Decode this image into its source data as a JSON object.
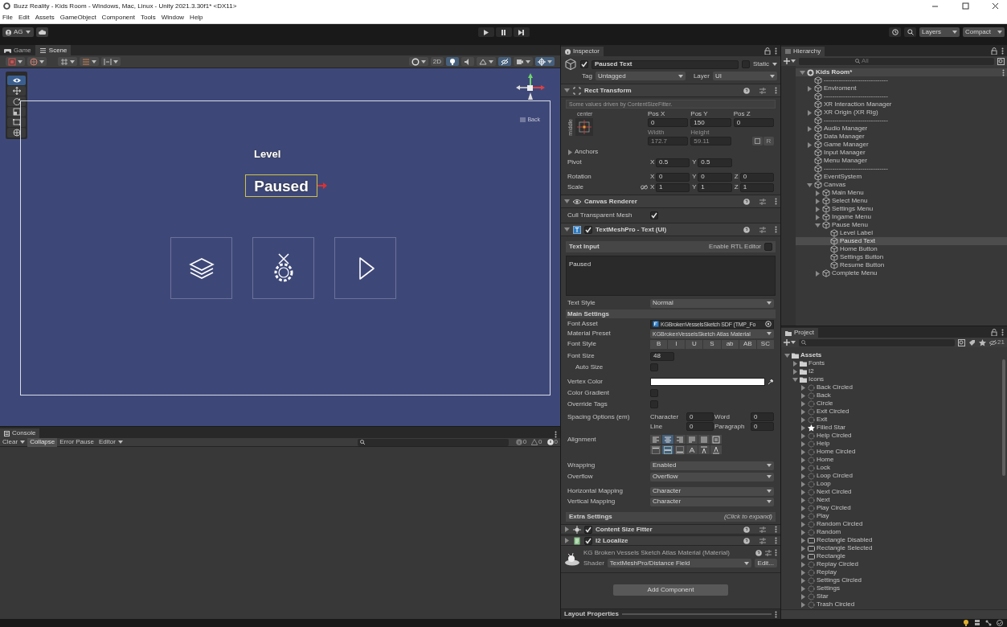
{
  "window": {
    "title": "Buzz Reality - Kids Room - Windows, Mac, Linux - Unity 2021.3.30f1* <DX11>"
  },
  "menu": [
    "File",
    "Edit",
    "Assets",
    "GameObject",
    "Component",
    "Tools",
    "Window",
    "Help"
  ],
  "toolbar": {
    "account": "AG",
    "layers": "Layers",
    "layout": "Compact"
  },
  "scene_panel": {
    "tabs": [
      {
        "label": "Game",
        "kind": "game",
        "selected": false
      },
      {
        "label": "Scene",
        "kind": "scene",
        "selected": true
      }
    ],
    "toolbar_left": [
      {
        "kind": "shading",
        "on": false,
        "dropdown": true
      },
      {
        "kind": "globe",
        "on": false,
        "dropdown": true
      },
      {
        "kind": "grid",
        "on": false,
        "dropdown": true
      },
      {
        "kind": "snap",
        "on": false,
        "dropdown": true
      },
      {
        "kind": "increment",
        "on": false,
        "dropdown": true
      }
    ],
    "toolbar_right": [
      {
        "kind": "orientation",
        "on": false,
        "dropdown": true
      },
      {
        "kind": "mode",
        "label": "2D",
        "on": false,
        "dropdown": false
      },
      {
        "kind": "lighting",
        "on": true,
        "dropdown": false
      },
      {
        "kind": "audio",
        "on": false,
        "dropdown": false
      },
      {
        "kind": "effects",
        "on": false,
        "dropdown": true
      },
      {
        "kind": "visibility",
        "on": true,
        "dropdown": false
      },
      {
        "kind": "camera",
        "on": false,
        "dropdown": true
      },
      {
        "kind": "gizmos",
        "on": true,
        "dropdown": true
      }
    ],
    "tools": [
      {
        "kind": "view",
        "selected": true
      },
      {
        "kind": "move",
        "selected": false
      },
      {
        "kind": "rotate",
        "selected": false
      },
      {
        "kind": "scale",
        "selected": false
      },
      {
        "kind": "rect",
        "selected": false
      },
      {
        "kind": "transform",
        "selected": false
      }
    ],
    "gizmo_label": "Back",
    "canvas": {
      "level_text": "Level",
      "paused_text": "Paused",
      "buttons": [
        {
          "kind": "layers"
        },
        {
          "kind": "settings"
        },
        {
          "kind": "play"
        }
      ]
    }
  },
  "console": {
    "title": "Console",
    "buttons": [
      {
        "label": "Clear",
        "selected": false,
        "dropdown": true
      },
      {
        "label": "Collapse",
        "selected": true,
        "dropdown": false
      },
      {
        "label": "Error Pause",
        "selected": false,
        "dropdown": false
      },
      {
        "label": "Editor",
        "selected": false,
        "dropdown": true
      }
    ],
    "counts": [
      {
        "kind": "info",
        "value": "0"
      },
      {
        "kind": "warning",
        "value": "0"
      },
      {
        "kind": "error",
        "value": "0"
      }
    ]
  },
  "inspector": {
    "title": "Inspector",
    "object": {
      "active": true,
      "name": "Paused Text",
      "static": false,
      "static_label": "Static",
      "tag_label": "Tag",
      "tag": "Untagged",
      "layer_label": "Layer",
      "layer": "UI"
    },
    "rect_transform": {
      "title": "Rect Transform",
      "expanded": true,
      "note": "Some values driven by ContentSizeFitter.",
      "anchor_h": "center",
      "anchor_v": "middle",
      "fields": [
        {
          "label": "Pos X",
          "value": "0",
          "disabled": false
        },
        {
          "label": "Pos Y",
          "value": "150",
          "disabled": false
        },
        {
          "label": "Pos Z",
          "value": "0",
          "disabled": false
        },
        {
          "label": "Width",
          "value": "172.7",
          "disabled": true
        },
        {
          "label": "Height",
          "value": "59.11",
          "disabled": true
        }
      ],
      "raw_button": "R",
      "anchors": {
        "label": "Anchors",
        "expanded": false
      },
      "rows": [
        {
          "label": "Pivot",
          "linked": false,
          "axes": [
            {
              "axis": "X",
              "value": "0.5"
            },
            {
              "axis": "Y",
              "value": "0.5"
            }
          ]
        },
        {
          "label": "Rotation",
          "linked": false,
          "axes": [
            {
              "axis": "X",
              "value": "0"
            },
            {
              "axis": "Y",
              "value": "0"
            },
            {
              "axis": "Z",
              "value": "0"
            }
          ]
        },
        {
          "label": "Scale",
          "linked": true,
          "axes": [
            {
              "axis": "X",
              "value": "1"
            },
            {
              "axis": "Y",
              "value": "1"
            },
            {
              "axis": "Z",
              "value": "1"
            }
          ]
        }
      ]
    },
    "canvas_renderer": {
      "title": "Canvas Renderer",
      "expanded": true,
      "cull_label": "Cull Transparent Mesh",
      "cull": true
    },
    "text_mesh_pro": {
      "title": "TextMeshPro - Text (UI)",
      "expanded": true,
      "enabled": true,
      "text_input_label": "Text Input",
      "rtl_label": "Enable RTL Editor",
      "rtl": false,
      "text": "Paused",
      "text_style_label": "Text Style",
      "text_style": "Normal",
      "main_settings": "Main Settings",
      "font_asset_label": "Font Asset",
      "font_asset": "KGBrokenVesselsSketch SDF (TMP_Fo",
      "material_preset_label": "Material Preset",
      "material_preset": "KGBrokenVesselsSketch Atlas Material",
      "font_style_label": "Font Style",
      "font_styles": [
        {
          "label": "B",
          "selected": false
        },
        {
          "label": "I",
          "selected": false
        },
        {
          "label": "U",
          "selected": false
        },
        {
          "label": "S",
          "selected": false
        },
        {
          "label": "ab",
          "selected": false
        },
        {
          "label": "AB",
          "selected": false
        },
        {
          "label": "SC",
          "selected": false
        }
      ],
      "font_size_label": "Font Size",
      "font_size": "48",
      "auto_size_label": "Auto Size",
      "auto_size": false,
      "vertex_color_label": "Vertex Color",
      "toggles": [
        {
          "label": "Color Gradient",
          "checked": false
        },
        {
          "label": "Override Tags",
          "checked": false
        }
      ],
      "spacing_label": "Spacing Options (em)",
      "spacing": [
        {
          "label": "Character",
          "value": "0"
        },
        {
          "label": "Word",
          "value": "0"
        },
        {
          "label": "Line",
          "value": "0"
        },
        {
          "label": "Paragraph",
          "value": "0"
        }
      ],
      "alignment_label": "Alignment",
      "alignment_rows": [
        [
          {
            "selected": false
          },
          {
            "selected": true
          },
          {
            "selected": false
          },
          {
            "selected": false
          },
          {
            "selected": false
          },
          {
            "selected": false
          }
        ],
        [
          {
            "selected": false
          },
          {
            "selected": true
          },
          {
            "selected": false
          },
          {
            "selected": false
          },
          {
            "selected": false
          },
          {
            "selected": false
          }
        ]
      ],
      "wrap_settings": [
        {
          "label": "Wrapping",
          "value": "Enabled"
        },
        {
          "label": "Overflow",
          "value": "Overflow"
        }
      ],
      "mapping_settings": [
        {
          "label": "Horizontal Mapping",
          "value": "Character"
        },
        {
          "label": "Vertical Mapping",
          "value": "Character"
        }
      ],
      "extra_settings": "Extra Settings",
      "extra_hint": "(Click to expand)"
    },
    "components": [
      {
        "title": "Content Size Fitter",
        "kind": "fitter",
        "enabled": true,
        "expanded": false
      },
      {
        "title": "I2 Localize",
        "kind": "localize",
        "enabled": true,
        "expanded": false
      }
    ],
    "material": {
      "title": "KG Broken Vessels Sketch Atlas Material (Material)",
      "shader_label": "Shader",
      "shader": "TextMeshPro/Distance Field",
      "edit": "Edit..."
    },
    "add_component": "Add Component",
    "layout_properties": "Layout Properties"
  },
  "hierarchy": {
    "title": "Hierarchy",
    "search_placeholder": "All",
    "scene": {
      "label": "Kids Room*",
      "expanded": true
    },
    "items": [
      {
        "label": "------------------------------",
        "selected": false
      },
      {
        "label": "Enviroment",
        "selected": false,
        "expanded": false
      },
      {
        "label": "------------------------------",
        "selected": false
      },
      {
        "label": "XR Interaction Manager",
        "selected": false
      },
      {
        "label": "XR Origin (XR Rig)",
        "selected": false,
        "expanded": false
      },
      {
        "label": "------------------------------",
        "selected": false
      },
      {
        "label": "Audio Manager",
        "selected": false,
        "expanded": false
      },
      {
        "label": "Data Manager",
        "selected": false
      },
      {
        "label": "Game Manager",
        "selected": false,
        "expanded": false
      },
      {
        "label": "Input Manager",
        "selected": false
      },
      {
        "label": "Menu Manager",
        "selected": false
      },
      {
        "label": "------------------------------",
        "selected": false
      },
      {
        "label": "EventSystem",
        "selected": false
      },
      {
        "label": "Canvas",
        "selected": false,
        "expanded": true,
        "children": [
          {
            "label": "Main Menu",
            "selected": false,
            "expanded": false
          },
          {
            "label": "Select Menu",
            "selected": false,
            "expanded": false
          },
          {
            "label": "Settings Menu",
            "selected": false,
            "expanded": false
          },
          {
            "label": "Ingame Menu",
            "selected": false,
            "expanded": false
          },
          {
            "label": "Pause Menu",
            "selected": false,
            "expanded": true,
            "children": [
              {
                "label": "Level Label",
                "selected": false
              },
              {
                "label": "Paused Text",
                "selected": true
              },
              {
                "label": "Home Button",
                "selected": false
              },
              {
                "label": "Settings Button",
                "selected": false
              },
              {
                "label": "Resume Button",
                "selected": false
              }
            ]
          },
          {
            "label": "Complete Menu",
            "selected": false,
            "expanded": false
          }
        ]
      }
    ]
  },
  "project": {
    "title": "Project",
    "hidden_count": "21",
    "tree": [
      {
        "label": "Assets",
        "kind": "folder",
        "expanded": true,
        "children": [
          {
            "label": "Fonts",
            "kind": "folder",
            "expanded": false
          },
          {
            "label": "I2",
            "kind": "folder",
            "expanded": false
          },
          {
            "label": "Icons",
            "kind": "folder",
            "expanded": true,
            "children": [
              {
                "label": "Back Circled",
                "kind": "sprite",
                "expanded": false
              },
              {
                "label": "Back",
                "kind": "sprite",
                "expanded": false
              },
              {
                "label": "Circle",
                "kind": "sprite",
                "expanded": false
              },
              {
                "label": "Exit Circled",
                "kind": "sprite",
                "expanded": false
              },
              {
                "label": "Exit",
                "kind": "sprite",
                "expanded": false
              },
              {
                "label": "Filled Star",
                "kind": "star",
                "expanded": false
              },
              {
                "label": "Help Circled",
                "kind": "sprite",
                "expanded": false
              },
              {
                "label": "Help",
                "kind": "sprite",
                "expanded": false
              },
              {
                "label": "Home Circled",
                "kind": "sprite",
                "expanded": false
              },
              {
                "label": "Home",
                "kind": "sprite",
                "expanded": false
              },
              {
                "label": "Lock",
                "kind": "sprite",
                "expanded": false
              },
              {
                "label": "Loop Circled",
                "kind": "sprite",
                "expanded": false
              },
              {
                "label": "Loop",
                "kind": "sprite",
                "expanded": false
              },
              {
                "label": "Next Circled",
                "kind": "sprite",
                "expanded": false
              },
              {
                "label": "Next",
                "kind": "sprite",
                "expanded": false
              },
              {
                "label": "Play Circled",
                "kind": "sprite",
                "expanded": false
              },
              {
                "label": "Play",
                "kind": "sprite",
                "expanded": false
              },
              {
                "label": "Random Circled",
                "kind": "sprite",
                "expanded": false
              },
              {
                "label": "Random",
                "kind": "sprite",
                "expanded": false
              },
              {
                "label": "Rectangle Disabled",
                "kind": "rect",
                "expanded": false
              },
              {
                "label": "Rectangle Selected",
                "kind": "rect",
                "expanded": false
              },
              {
                "label": "Rectangle",
                "kind": "rect",
                "expanded": false
              },
              {
                "label": "Replay Circled",
                "kind": "sprite",
                "expanded": false
              },
              {
                "label": "Replay",
                "kind": "sprite",
                "expanded": false
              },
              {
                "label": "Settings Circled",
                "kind": "sprite",
                "expanded": false
              },
              {
                "label": "Settings",
                "kind": "sprite",
                "expanded": false
              },
              {
                "label": "Star",
                "kind": "sprite",
                "expanded": false
              },
              {
                "label": "Trash Circled",
                "kind": "sprite",
                "expanded": false
              }
            ]
          }
        ]
      }
    ]
  }
}
